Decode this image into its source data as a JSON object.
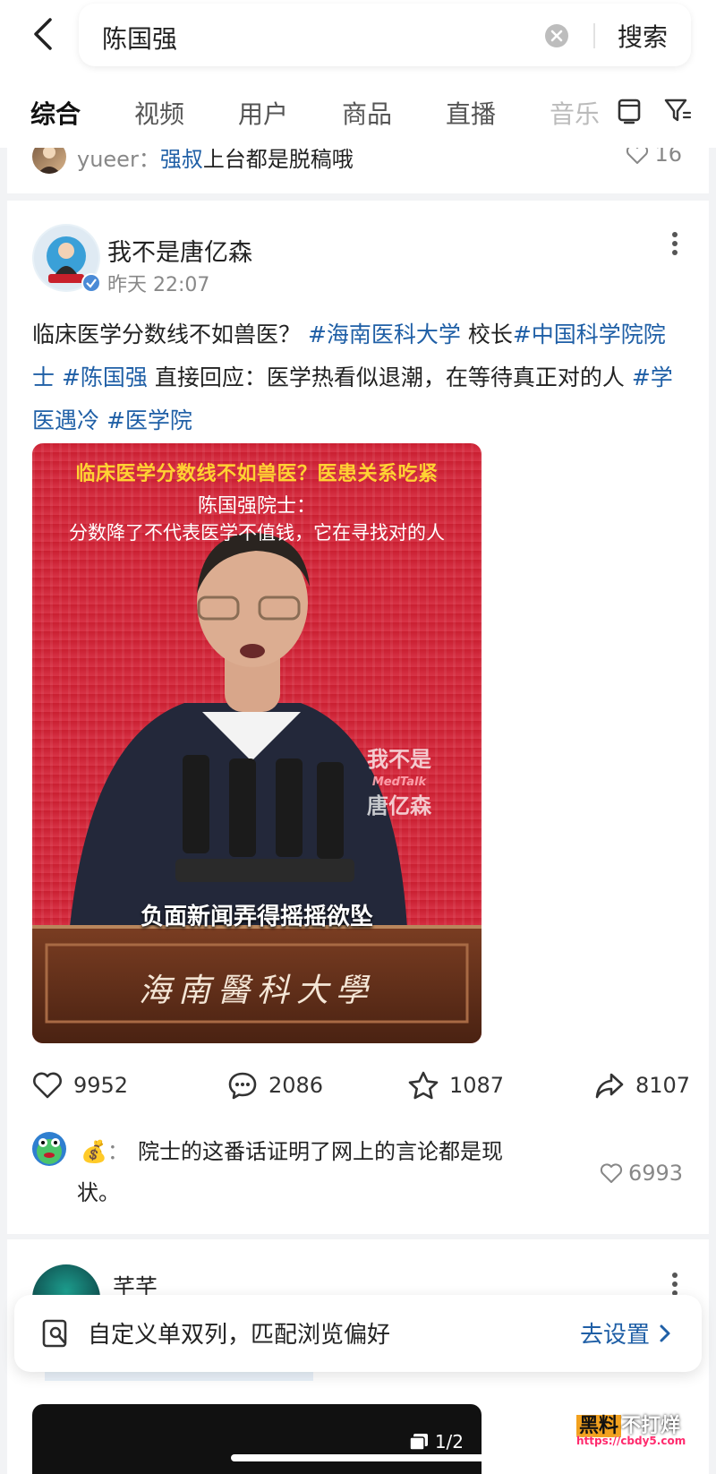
{
  "search": {
    "query": "陈国强",
    "button_label": "搜索"
  },
  "tabs": [
    {
      "label": "综合",
      "active": true
    },
    {
      "label": "视频",
      "active": false
    },
    {
      "label": "用户",
      "active": false
    },
    {
      "label": "商品",
      "active": false
    },
    {
      "label": "直播",
      "active": false
    },
    {
      "label": "音乐",
      "active": false
    }
  ],
  "prev_comment": {
    "user": "yueer",
    "sep": "：",
    "mention": "强叔",
    "text": "上台都是脱稿哦",
    "likes": "16"
  },
  "post": {
    "author": "我不是唐亿森",
    "time": "昨天 22:07",
    "body_plain_1": "临床医学分数线不如兽医？ ",
    "tag_1": "#海南医科大学",
    "body_plain_2": " 校长",
    "tag_2": "#中国科学院院士",
    "tag_3": "#陈国强",
    "body_plain_3": " 直接回应：医学热看似退潮，在等待真正对的人 ",
    "tag_4": "#学医遇冷",
    "tag_5": "#医学院",
    "video": {
      "caption_top": "临床医学分数线不如兽医？医患关系吃紧",
      "caption_sub1": "陈国强院士：",
      "caption_sub2": "分数降了不代表医学不值钱，它在寻找对的人",
      "caption_bottom": "负面新闻弄得摇摇欲坠",
      "podium_text": "海南醫科大學",
      "wm_line1": "我不是",
      "wm_line2": "MedTalk",
      "wm_line3": "唐亿森",
      "avatar_badge": "我不是唐亿森"
    },
    "stats": {
      "likes": "9952",
      "comments": "2086",
      "favorites": "1087",
      "shares": "8107"
    },
    "top_comment": {
      "user_emoji": "💰",
      "sep": "：",
      "text_line1": "院士的这番话证明了网上的言论都是现",
      "text_line2": "状。",
      "likes": "6993"
    }
  },
  "next_post": {
    "author": "芊芊",
    "image_counter": "1/2"
  },
  "settings_bar": {
    "text": "自定义单双列，匹配浏览偏好",
    "link": "去设置"
  },
  "watermark": {
    "part1": "黑料",
    "part2": "不打烊",
    "url": "https://cbdy5.com"
  },
  "colors": {
    "link": "#1f5fa6",
    "video_red": "#d62f3c",
    "caption_yellow": "#ffd233"
  }
}
